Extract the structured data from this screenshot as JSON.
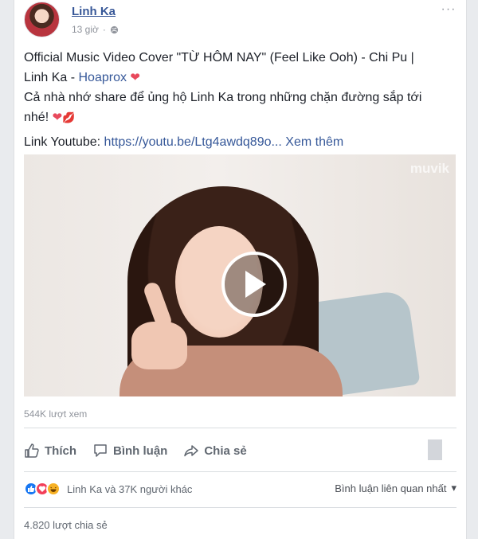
{
  "post": {
    "author": "Linh Ka",
    "time": "13 giờ",
    "more_label": "···",
    "line1": "Official Music Video Cover \"TỪ HÔM NAY\" (Feel Like Ooh) - Chi Pu |",
    "line2_prefix": "Linh Ka - ",
    "line2_link": "Hoaprox",
    "line3": "Cả nhà nhớ share để ủng hộ Linh Ka trong những chặn đường sắp tới",
    "line4": "nhé!",
    "youtube_label": "Link Youtube: ",
    "youtube_url": "https://youtu.be/Ltg4awdq89o...",
    "see_more": "Xem thêm"
  },
  "video": {
    "watermark": "muvik",
    "views": "544K lượt xem"
  },
  "actions": {
    "like": "Thích",
    "comment": "Bình luận",
    "share": "Chia sẻ"
  },
  "stats": {
    "reactions_text": "Linh Ka và 37K người khác",
    "sort_label": "Bình luận liên quan nhất",
    "shares": "4.820 lượt chia sẻ"
  },
  "colors": {
    "link": "#365899",
    "like": "#1877f2",
    "love": "#f33e58",
    "haha": "#f7b125"
  }
}
